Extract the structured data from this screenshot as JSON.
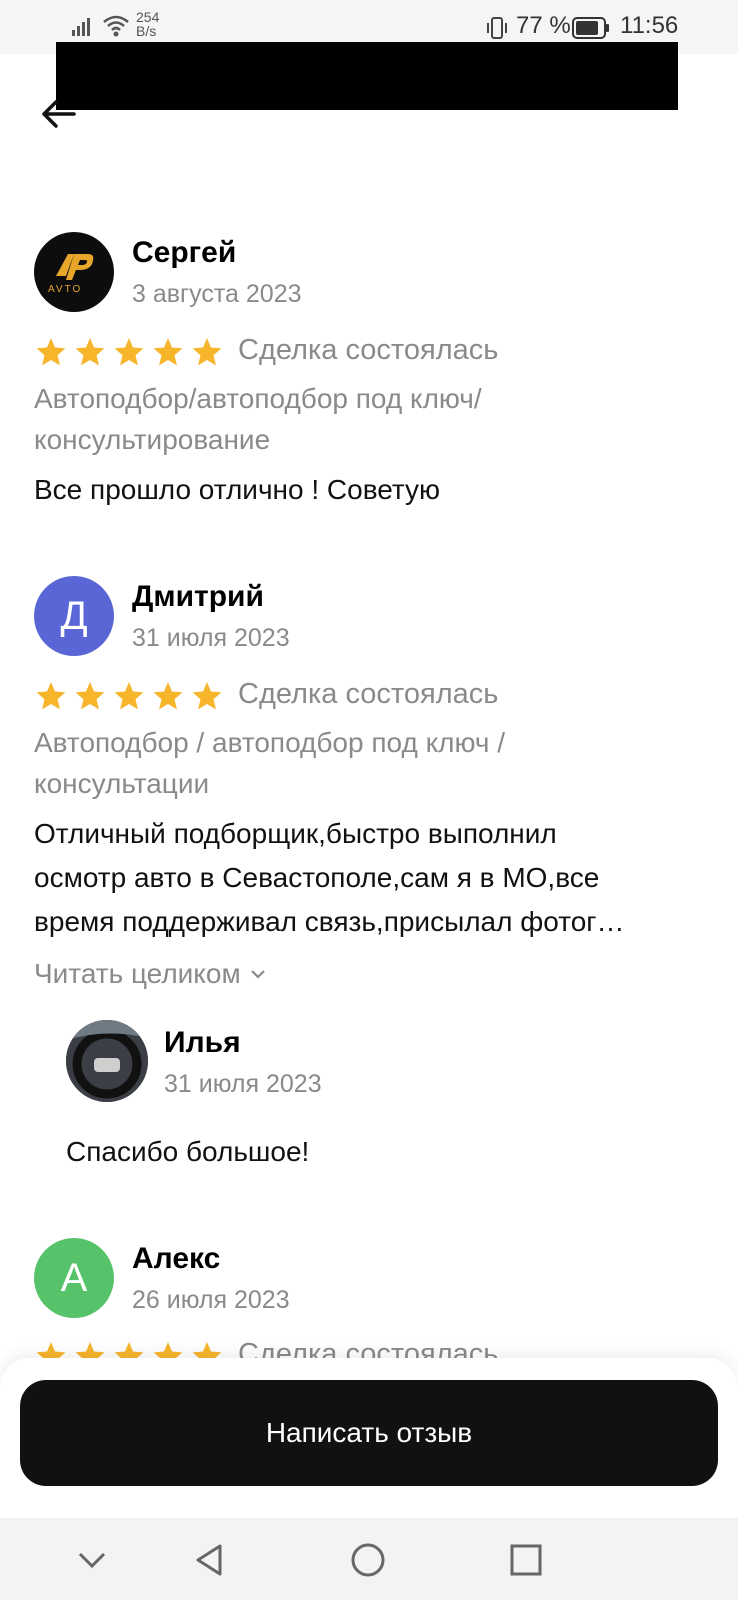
{
  "status_bar": {
    "speed_value": "254",
    "speed_unit": "B/s",
    "battery": "77 %",
    "time": "11:56"
  },
  "reviews": [
    {
      "name": "Сергей",
      "date": "3 августа 2023",
      "rating": 5,
      "deal": "Сделка состоялась",
      "category": "Автоподбор/автоподбор под ключ/ консультирование",
      "text": "Все прошло отлично ! Советую",
      "avatar_logo_text": "AVTO",
      "avatar_letters": "AP"
    },
    {
      "name": "Дмитрий",
      "date": "31 июля 2023",
      "rating": 5,
      "avatar_letter": "Д",
      "avatar_color": "#5a66d6",
      "deal": "Сделка состоялась",
      "category": "Автоподбор / автоподбор под ключ / консультации",
      "text_lines": [
        "Отличный подборщик,быстро выполнил",
        "осмотр авто в Севастополе,сам я в МО,все",
        "время поддерживал связь,присылал фотог…"
      ],
      "read_more": "Читать целиком"
    },
    {
      "name": "Алекс",
      "date": "26 июля 2023",
      "rating": 5,
      "avatar_letter": "А",
      "avatar_color": "#56c26a",
      "deal": "Сделка состоялась"
    }
  ],
  "reply": {
    "name": "Илья",
    "date": "31 июля 2023",
    "text": "Спасибо большое!"
  },
  "actions": {
    "write_review": "Написать отзыв"
  },
  "colors": {
    "star": "#f7b52c",
    "button_bg": "#111111"
  }
}
